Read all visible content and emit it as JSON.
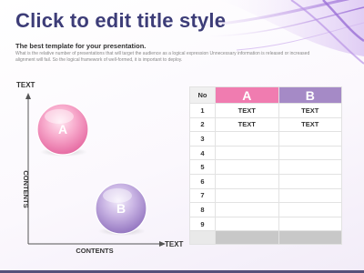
{
  "title": "Click to edit title style",
  "subtitle": "The best template for your presentation.",
  "description": "What is the relative number of presentations that will target the audience as a logical expression Unnecessary information is released or increased alignment will fail. So the logical framework of well-formed, it is important to deploy.",
  "diagram": {
    "y_axis_label": "TEXT",
    "y_axis_vertical_label": "CONTENTS",
    "x_axis_label": "CONTENTS",
    "x_axis_end_label": "TEXT",
    "bubble_a": "A",
    "bubble_b": "B",
    "colors": {
      "pink": "#f07cb0",
      "purple": "#a58ac6"
    }
  },
  "table": {
    "headers": {
      "no": "No",
      "a": "A",
      "b": "B"
    },
    "rows": [
      {
        "no": "1",
        "a": "TEXT",
        "b": "TEXT"
      },
      {
        "no": "2",
        "a": "TEXT",
        "b": "TEXT"
      },
      {
        "no": "3",
        "a": "",
        "b": ""
      },
      {
        "no": "4",
        "a": "",
        "b": ""
      },
      {
        "no": "5",
        "a": "",
        "b": ""
      },
      {
        "no": "6",
        "a": "",
        "b": ""
      },
      {
        "no": "7",
        "a": "",
        "b": ""
      },
      {
        "no": "8",
        "a": "",
        "b": ""
      },
      {
        "no": "9",
        "a": "",
        "b": ""
      }
    ]
  }
}
